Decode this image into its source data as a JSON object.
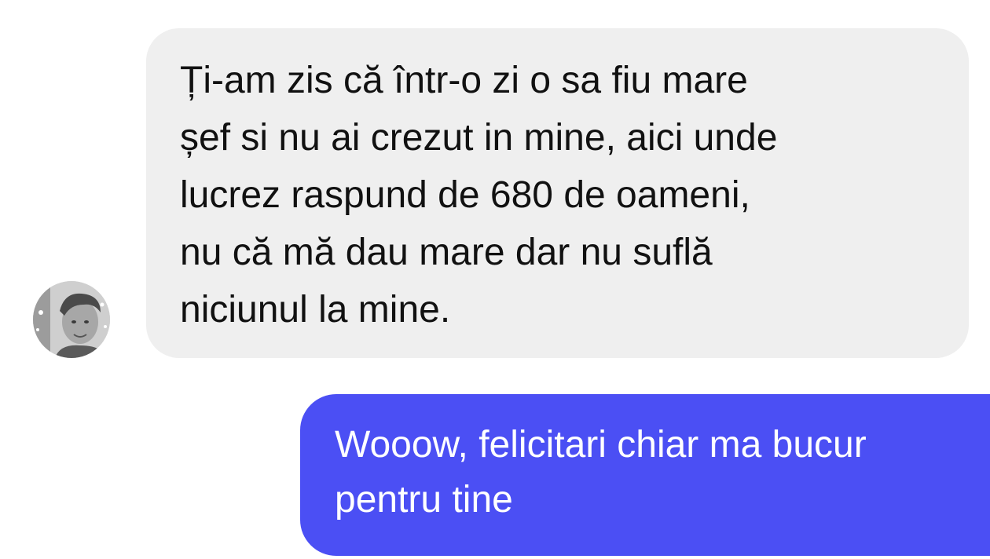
{
  "incoming_message": {
    "text": "Ți-am zis că într-o zi o sa fiu mare\nșef si nu ai crezut in mine, aici unde\nlucrez raspund de 680 de oameni,\nnu că mă dau mare dar nu suflă\nniciunul la mine."
  },
  "outgoing_message": {
    "text": "Wooow, felicitari chiar ma bucur\npentru tine"
  },
  "colors": {
    "incoming_bubble": "#efefef",
    "outgoing_bubble": "#4b4ff4",
    "incoming_text": "#111111",
    "outgoing_text": "#ffffff"
  },
  "icons": {
    "avatar": "contact-avatar-photo"
  }
}
